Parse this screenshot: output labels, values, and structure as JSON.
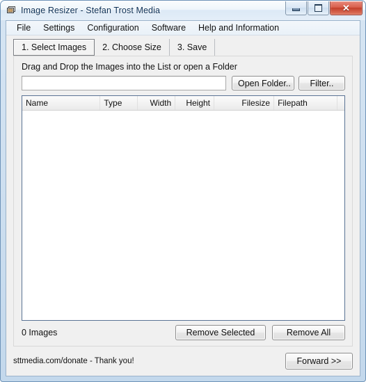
{
  "window": {
    "title": "Image Resizer - Stefan Trost Media",
    "icon": "stacked-images-icon",
    "controls": {
      "minimize": "minimize-icon",
      "maximize": "maximize-icon",
      "close": "✕"
    }
  },
  "menubar": {
    "items": [
      {
        "label": "File"
      },
      {
        "label": "Settings"
      },
      {
        "label": "Configuration"
      },
      {
        "label": "Software"
      },
      {
        "label": "Help and Information"
      }
    ]
  },
  "tabs": {
    "selected_index": 0,
    "items": [
      {
        "label": "1. Select Images"
      },
      {
        "label": "2. Choose Size"
      },
      {
        "label": "3. Save"
      }
    ]
  },
  "main": {
    "hint": "Drag and Drop the Images into the List or open a Folder",
    "path_input": {
      "value": "",
      "placeholder": ""
    },
    "open_folder_button": "Open Folder..",
    "filter_button": "Filter..",
    "list": {
      "columns": [
        {
          "label": "Name",
          "align": "left",
          "width": 115
        },
        {
          "label": "Type",
          "align": "left",
          "width": 55
        },
        {
          "label": "Width",
          "align": "right",
          "width": 55
        },
        {
          "label": "Height",
          "align": "right",
          "width": 57
        },
        {
          "label": "Filesize",
          "align": "right",
          "width": 88
        },
        {
          "label": "Filepath",
          "align": "left",
          "width": 93
        },
        {
          "label": "",
          "align": "left",
          "width": 28
        }
      ],
      "rows": []
    },
    "count_label": "0 Images",
    "remove_selected_button": "Remove Selected",
    "remove_all_button": "Remove All"
  },
  "statusbar": {
    "text": "sttmedia.com/donate - Thank you!",
    "forward_button": "Forward >>"
  },
  "colors": {
    "frame": "#6e93b8",
    "panel_bg": "#f0f0f0",
    "list_border": "#5a7394",
    "close_button": "#c33f2b"
  }
}
